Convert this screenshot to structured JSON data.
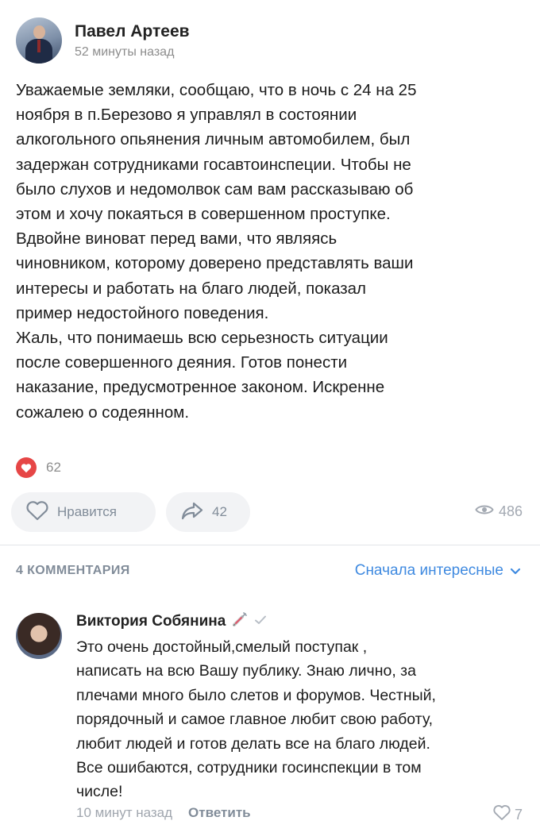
{
  "post": {
    "author": "Павел Артеев",
    "time": "52 минуты назад",
    "text": "Уважаемые земляки, сообщаю, что в ночь с 24 на 25\nноября в п.Березово я управлял в состоянии\nалкогольного опьянения личным автомобилем, был\nзадержан сотрудниками госавтоинспеции. Чтобы не\nбыло слухов и недомолвок сам вам рассказываю об\nэтом и хочу покаяться в совершенном проступке.\nВдвойне виноват перед вами, что являясь\nчиновником, которому доверено представлять ваши\nинтересы и работать на благо людей, показал\nпример недостойного поведения.\nЖаль, что понимаешь всю серьезность ситуации\nпосле совершенного деяния. Готов понести\nнаказание, предусмотренное законом. Искренне\nсожалею о содеянном.",
    "reactions_count": "62",
    "like_label": "Нравится",
    "shares": "42",
    "views": "486"
  },
  "comments_header": {
    "count_label": "4 КОММЕНТАРИЯ",
    "sort_label": "Сначала интересные"
  },
  "comment": {
    "author": "Виктория Собянина",
    "text": "Это очень достойный,смелый  поступак ,\nнаписать на всю Вашу публику. Знаю лично, за\nплечами много было слетов и форумов. Честный,\nпорядочный и самое главное любит свою работу,\nлюбит людей и готов делать все на благо людей.\nВсе ошибаются, сотрудники госинспекции в том\nчисле!",
    "time": "10 минут назад",
    "reply_label": "Ответить",
    "likes": "7"
  },
  "colors": {
    "accent": "#3f8ae0",
    "heart": "#e64646",
    "muted": "#818c99",
    "button_bg": "#f2f3f5"
  },
  "icons": {
    "reaction": "heart-icon",
    "like": "heart-outline-icon",
    "share": "share-arrow-icon",
    "views": "eye-icon",
    "sort": "chevron-down-icon",
    "badge": "syringe-emoji-icon",
    "verified": "check-icon"
  }
}
